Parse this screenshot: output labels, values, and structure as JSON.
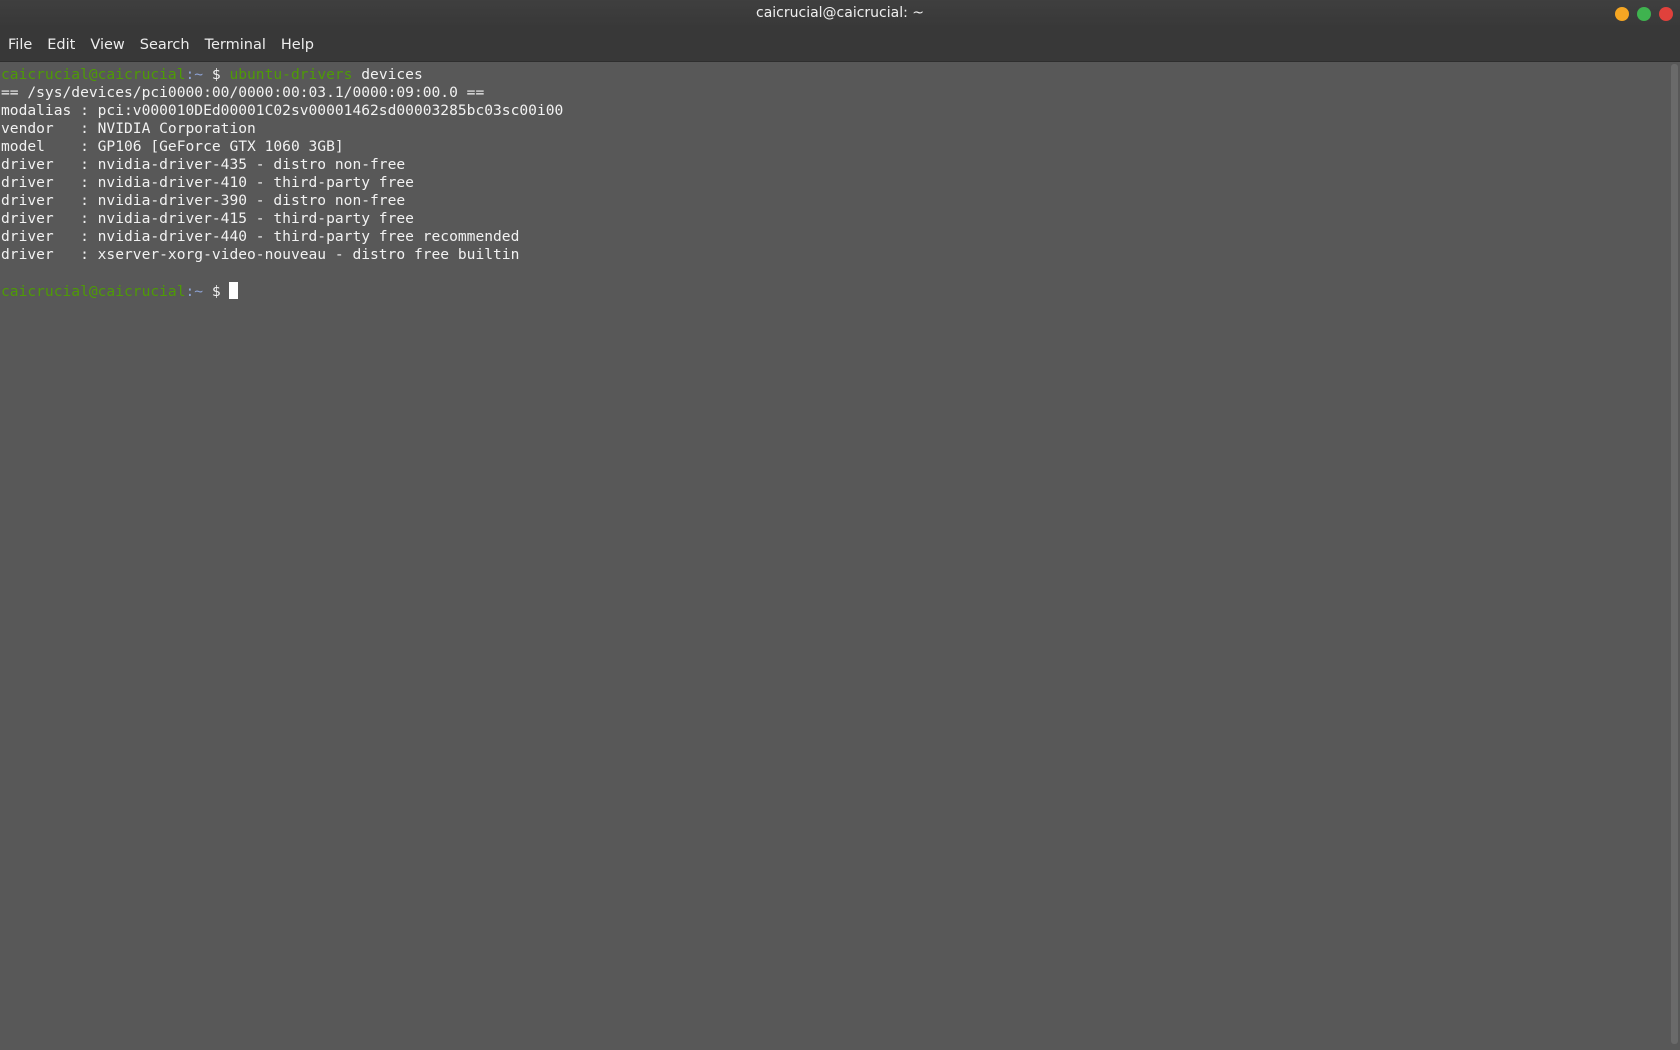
{
  "window": {
    "title": "caicrucial@caicrucial: ~",
    "buttons": {
      "minimize_color": "#f5a623",
      "maximize_color": "#3fb34f",
      "close_color": "#e0413c"
    }
  },
  "menu": {
    "items": [
      "File",
      "Edit",
      "View",
      "Search",
      "Terminal",
      "Help"
    ]
  },
  "terminal": {
    "prompt": {
      "user_host": "caicrucial@caicrucial",
      "path": ":~",
      "symbol": " $ "
    },
    "command": {
      "name": "ubuntu-drivers",
      "args": " devices"
    },
    "output": [
      "== /sys/devices/pci0000:00/0000:00:03.1/0000:09:00.0 ==",
      "modalias : pci:v000010DEd00001C02sv00001462sd00003285bc03sc00i00",
      "vendor   : NVIDIA Corporation",
      "model    : GP106 [GeForce GTX 1060 3GB]",
      "driver   : nvidia-driver-435 - distro non-free",
      "driver   : nvidia-driver-410 - third-party free",
      "driver   : nvidia-driver-390 - distro non-free",
      "driver   : nvidia-driver-415 - third-party free",
      "driver   : nvidia-driver-440 - third-party free recommended",
      "driver   : xserver-xorg-video-nouveau - distro free builtin"
    ]
  }
}
